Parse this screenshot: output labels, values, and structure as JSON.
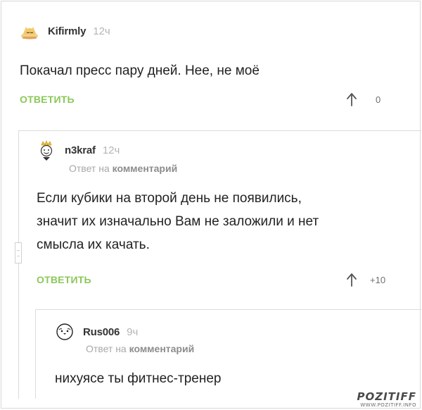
{
  "comments": [
    {
      "username": "Kifirmly",
      "time": "12ч",
      "text": "Покачал пресс пару дней. Нее, не моё",
      "reply_label": "ОТВЕТИТЬ",
      "rating": "0",
      "avatar_icon": "sleeping-cat-avatar"
    },
    {
      "username": "n3kraf",
      "time": "12ч",
      "reply_to_prefix": "Ответ на",
      "reply_to_target": "комментарий",
      "text_lines": [
        "Если кубики на второй день не появились,",
        "значит их изначально Вам не заложили и нет",
        "смысла их качать."
      ],
      "reply_label": "ОТВЕТИТЬ",
      "rating": "+10",
      "avatar_icon": "crowned-face-avatar"
    },
    {
      "username": "Rus006",
      "time": "9ч",
      "reply_to_prefix": "Ответ на",
      "reply_to_target": "комментарий",
      "text": "нихуясе ты фитнес-тренер",
      "rating": "",
      "avatar_icon": "face-avatar"
    }
  ],
  "watermark": {
    "logo": "POZITIFF",
    "url": "WWW.POZITIFF.INFO"
  },
  "colors": {
    "reply_button": "#8ac858",
    "username": "#333333",
    "meta": "#b5b5b5",
    "thread_line": "#dcdcdc"
  }
}
